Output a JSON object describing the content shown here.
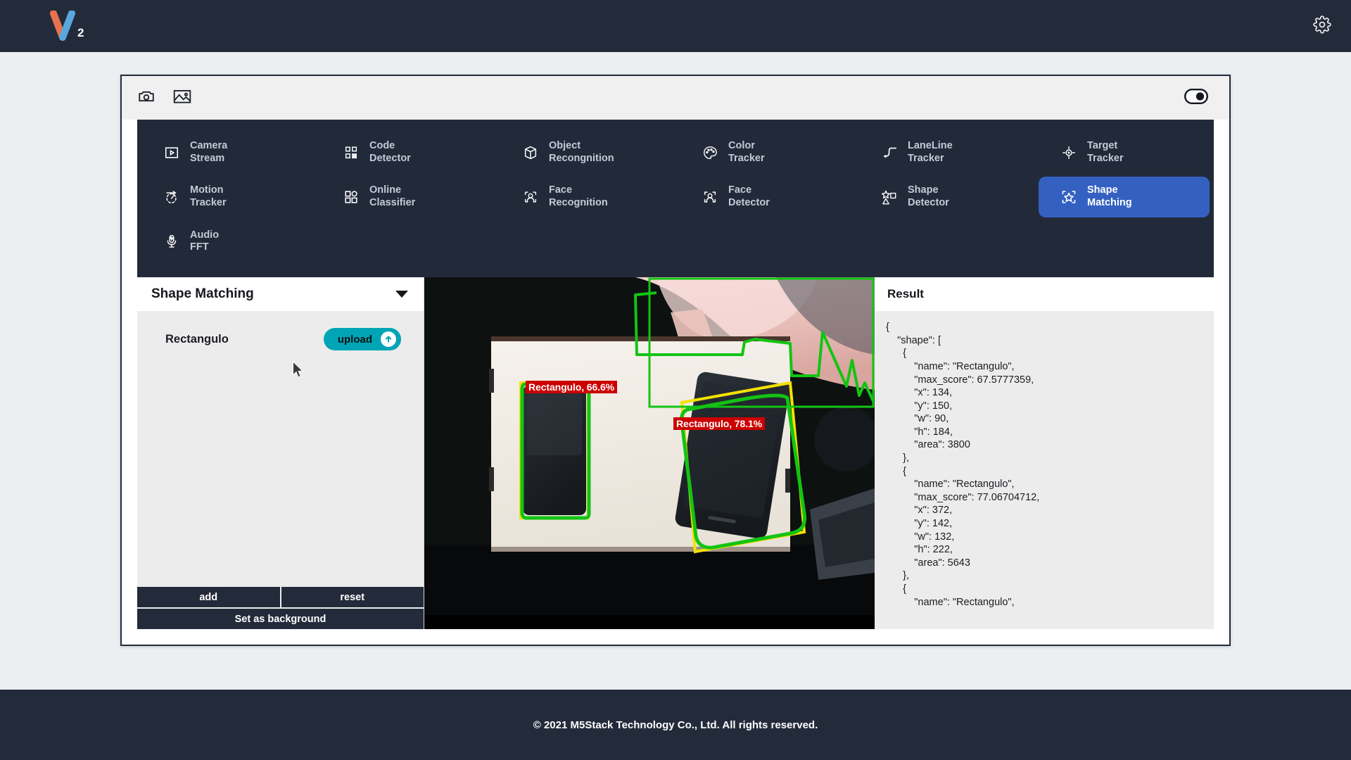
{
  "header": {
    "logo_name": "v2-logo",
    "logo_sub": "2",
    "settings_icon": "gear-icon"
  },
  "toolbar": {
    "camera_icon": "camera-icon",
    "image_icon": "image-icon",
    "toggle_icon": "toggle-switch",
    "toggle_state": "on"
  },
  "functions": [
    {
      "line1": "Camera",
      "line2": "Stream",
      "icon": "camera-stream-icon",
      "active": false
    },
    {
      "line1": "Code",
      "line2": "Detector",
      "icon": "qr-code-icon",
      "active": false
    },
    {
      "line1": "Object",
      "line2": "Recongnition",
      "icon": "cube-icon",
      "active": false
    },
    {
      "line1": "Color",
      "line2": "Tracker",
      "icon": "palette-icon",
      "active": false
    },
    {
      "line1": "LaneLine",
      "line2": "Tracker",
      "icon": "laneline-icon",
      "active": false
    },
    {
      "line1": "Target",
      "line2": "Tracker",
      "icon": "crosshair-icon",
      "active": false
    },
    {
      "line1": "Motion",
      "line2": "Tracker",
      "icon": "motion-icon",
      "active": false
    },
    {
      "line1": "Online",
      "line2": "Classifier",
      "icon": "grid-squares-icon",
      "active": false
    },
    {
      "line1": "Face",
      "line2": "Recognition",
      "icon": "face-recognition-icon",
      "active": false
    },
    {
      "line1": "Face",
      "line2": "Detector",
      "icon": "face-detector-icon",
      "active": false
    },
    {
      "line1": "Shape",
      "line2": "Detector",
      "icon": "shapes-icon",
      "active": false
    },
    {
      "line1": "Shape",
      "line2": "Matching",
      "icon": "shape-matching-icon",
      "active": true
    },
    {
      "line1": "Audio",
      "line2": "FFT",
      "icon": "microphone-icon",
      "active": false
    }
  ],
  "left_panel": {
    "title": "Shape Matching",
    "caret_icon": "chevron-down-icon",
    "shape_name": "Rectangulo",
    "upload_label": "upload",
    "upload_icon": "upload-arrow-icon",
    "add_label": "add",
    "reset_label": "reset",
    "background_label": "Set as background"
  },
  "preview": {
    "detections": [
      {
        "label": "Rectangulo, 66.6%",
        "box_color": "#00c000"
      },
      {
        "label": "Rectangulo, 78.1%",
        "box_color": "#00c000"
      }
    ],
    "template_box_color": "#f5e100",
    "contour_color": "#13c413",
    "chip_bg": "#cc0000"
  },
  "result": {
    "title": "Result",
    "json_text": "{\n    \"shape\": [\n      {\n          \"name\": \"Rectangulo\",\n          \"max_score\": 67.5777359,\n          \"x\": 134,\n          \"y\": 150,\n          \"w\": 90,\n          \"h\": 184,\n          \"area\": 3800\n      },\n      {\n          \"name\": \"Rectangulo\",\n          \"max_score\": 77.06704712,\n          \"x\": 372,\n          \"y\": 142,\n          \"w\": 132,\n          \"h\": 222,\n          \"area\": 5643\n      },\n      {\n          \"name\": \"Rectangulo\","
  },
  "footer": {
    "copyright": "© 2021 M5Stack Technology Co., Ltd. All rights reserved."
  },
  "colors": {
    "dark": "#232b3b",
    "accent_blue": "#3461c1",
    "teal": "#00a5b5",
    "page_bg": "#eceff1"
  }
}
